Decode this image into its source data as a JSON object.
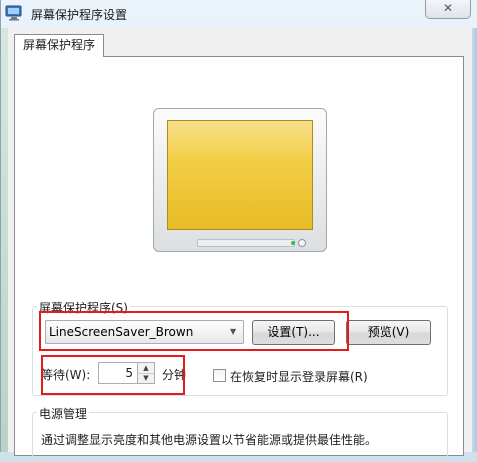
{
  "window": {
    "title": "屏幕保护程序设置",
    "close_glyph": "✕"
  },
  "tab": {
    "label": "屏幕保护程序"
  },
  "screensaver_group": {
    "label": "屏幕保护程序(S)",
    "selected": "LineScreenSaver_Brown",
    "settings_button": "设置(T)...",
    "preview_button": "预览(V)",
    "wait_label": "等待(W):",
    "wait_value": "5",
    "wait_unit": "分钟",
    "resume_logon_label": "在恢复时显示登录屏幕(R)",
    "resume_logon_checked": false
  },
  "power_group": {
    "label": "电源管理",
    "description": "通过调整显示亮度和其他电源设置以节省能源或提供最佳性能。"
  },
  "colors": {
    "highlight_box": "#e31b1b",
    "screen": "#f2cf48"
  }
}
